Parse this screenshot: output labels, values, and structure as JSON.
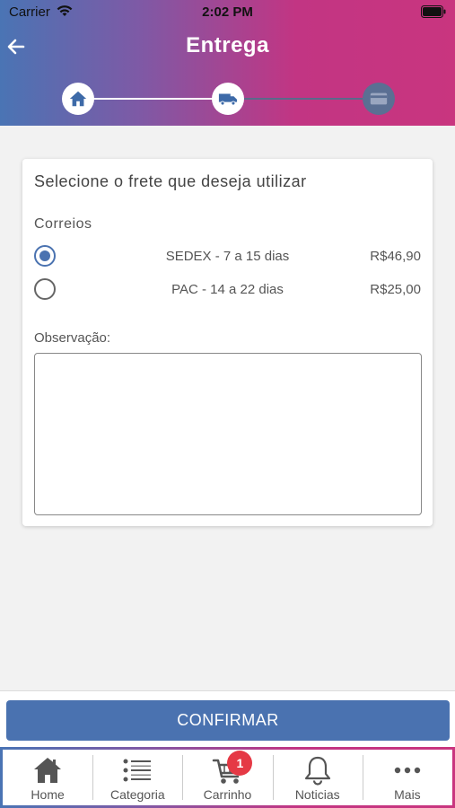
{
  "status_bar": {
    "carrier": "Carrier",
    "time": "2:02 PM"
  },
  "header": {
    "title": "Entrega"
  },
  "stepper": {
    "steps": [
      {
        "icon": "home-icon",
        "state": "complete"
      },
      {
        "icon": "truck-icon",
        "state": "current"
      },
      {
        "icon": "credit-card-icon",
        "state": "pending"
      }
    ]
  },
  "shipping": {
    "heading": "Selecione o frete que deseja utilizar",
    "carrier_name": "Correios",
    "options": [
      {
        "label": "SEDEX - 7 a 15 dias",
        "price": "R$46,90",
        "selected": true
      },
      {
        "label": "PAC - 14 a 22 dias",
        "price": "R$25,00",
        "selected": false
      }
    ],
    "observation_label": "Observação:",
    "observation_value": ""
  },
  "confirm_label": "CONFIRMAR",
  "tabbar": {
    "items": [
      {
        "label": "Home",
        "icon": "home-icon"
      },
      {
        "label": "Categoria",
        "icon": "list-icon"
      },
      {
        "label": "Carrinho",
        "icon": "cart-icon",
        "badge": "1"
      },
      {
        "label": "Noticias",
        "icon": "bell-icon"
      },
      {
        "label": "Mais",
        "icon": "more-icon"
      }
    ]
  },
  "colors": {
    "accent": "#4a72b0",
    "gradient_start": "#4a74b4",
    "gradient_end": "#c9357f",
    "badge": "#e53945"
  }
}
